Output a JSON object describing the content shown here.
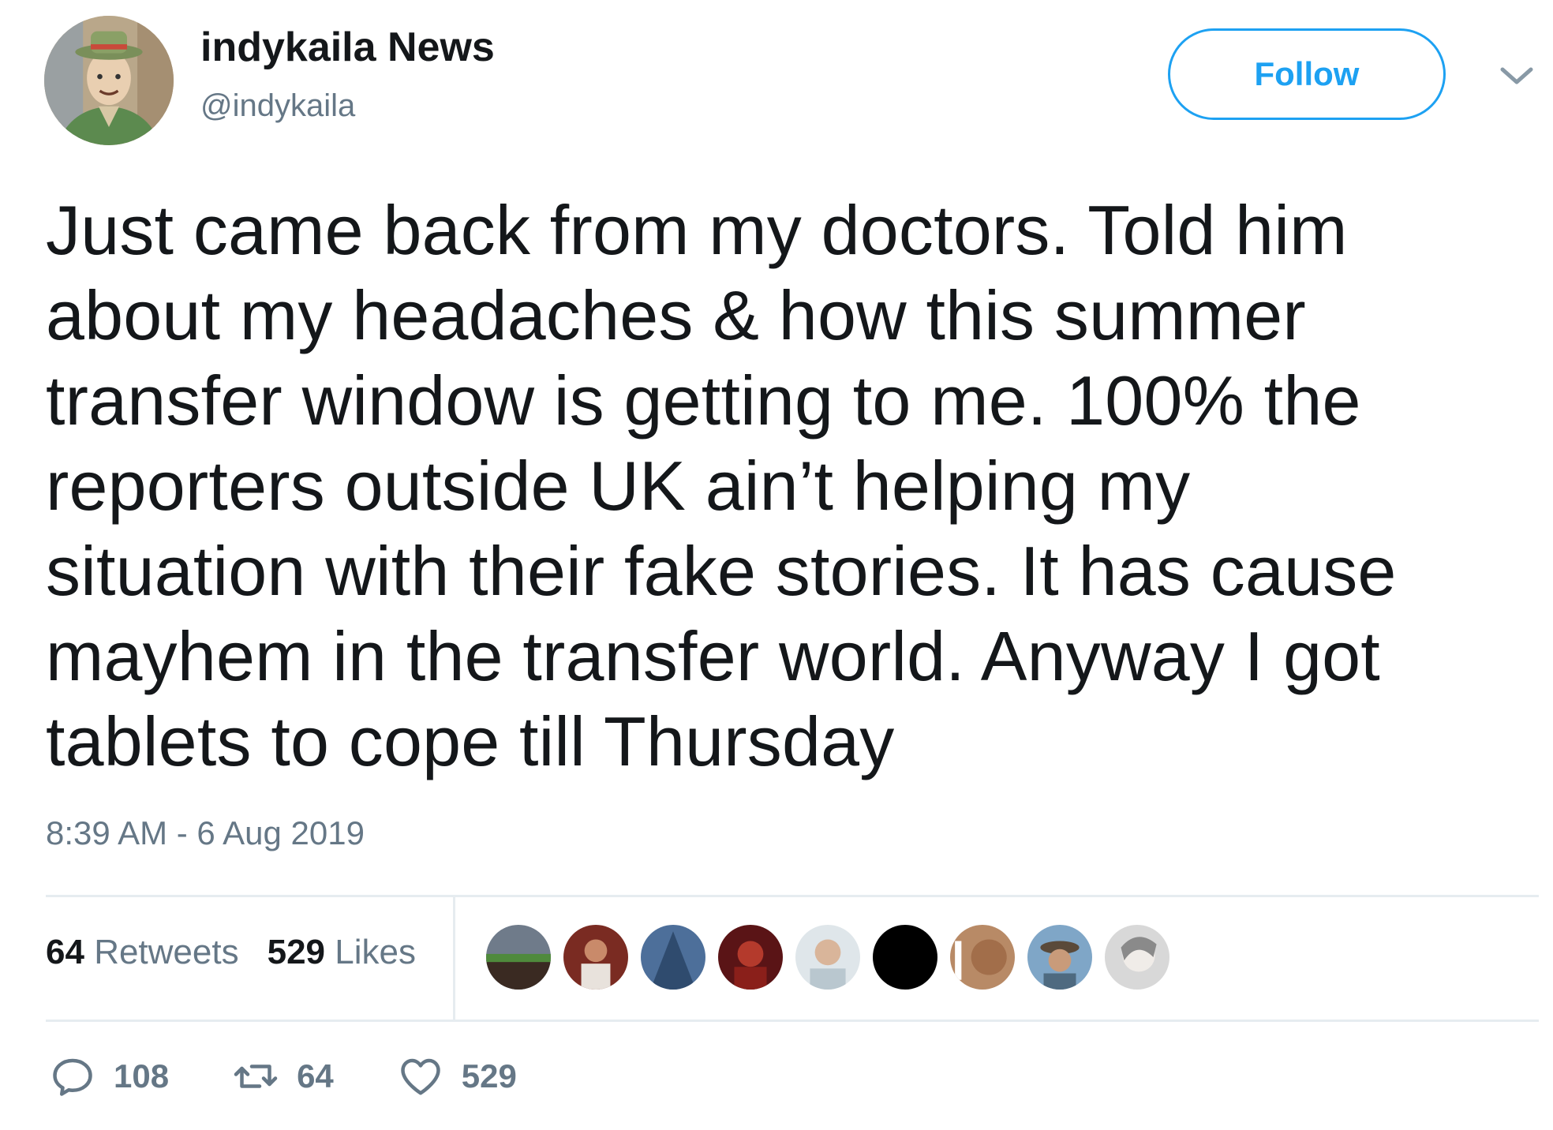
{
  "author": {
    "display_name": "indykaila News",
    "handle": "@indykaila",
    "avatar_icon": "cartoon-man-with-hat-avatar"
  },
  "follow_button": {
    "label": "Follow"
  },
  "tweet": {
    "text": "Just came back from my doctors. Told him\nabout my headaches & how this summer\ntransfer window is getting to me. 100% the\nreporters outside UK ain’t helping my\nsituation with their fake stories. It has cause\nmayhem in the transfer world. Anyway I got\ntablets to cope till Thursday",
    "timestamp": "8:39 AM - 6 Aug 2019"
  },
  "stats": {
    "retweets_count": "64",
    "retweets_label": "Retweets",
    "likes_count": "529",
    "likes_label": "Likes"
  },
  "actions": {
    "replies": "108",
    "retweets": "64",
    "likes": "529"
  },
  "colors": {
    "accent": "#1da1f2",
    "text": "#14171a",
    "muted": "#657786",
    "divider": "#e6ecf0"
  }
}
